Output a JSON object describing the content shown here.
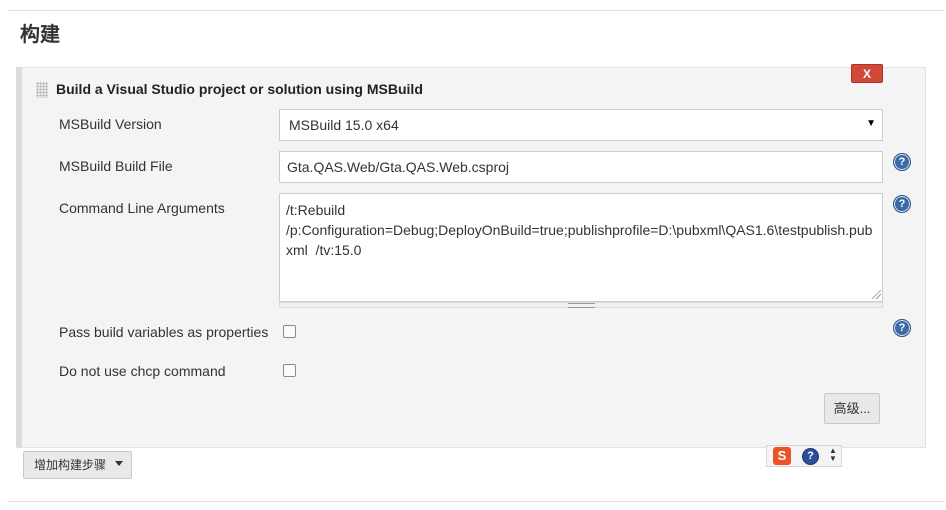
{
  "section": {
    "title": "构建"
  },
  "step": {
    "title": "Build a Visual Studio project or solution using MSBuild",
    "delete_label": "x"
  },
  "fields": {
    "version": {
      "label": "MSBuild Version",
      "value": "MSBuild 15.0 x64"
    },
    "build_file": {
      "label": "MSBuild Build File",
      "value": "Gta.QAS.Web/Gta.QAS.Web.csproj"
    },
    "args": {
      "label": "Command Line Arguments",
      "value": "/t:Rebuild\n/p:Configuration=Debug;DeployOnBuild=true;publishprofile=D:\\pubxml\\QAS1.6\\testpublish.pubxml  /tv:15.0"
    },
    "pass_vars": {
      "label": "Pass build variables as properties",
      "checked": false
    },
    "no_chcp": {
      "label": "Do not use chcp command",
      "checked": false
    }
  },
  "advanced_label": "高级...",
  "add_step_label": "增加构建步骤",
  "help_glyph": "?",
  "tray": {
    "s_glyph": "S",
    "help_glyph": "?"
  },
  "icons": [
    "drag-handle-icon",
    "help-icon",
    "chevron-down-icon",
    "sogou-s-icon"
  ],
  "colors": {
    "delete": "#d24939",
    "help": "#3b6aa8",
    "panel": "#f4f4f4"
  }
}
